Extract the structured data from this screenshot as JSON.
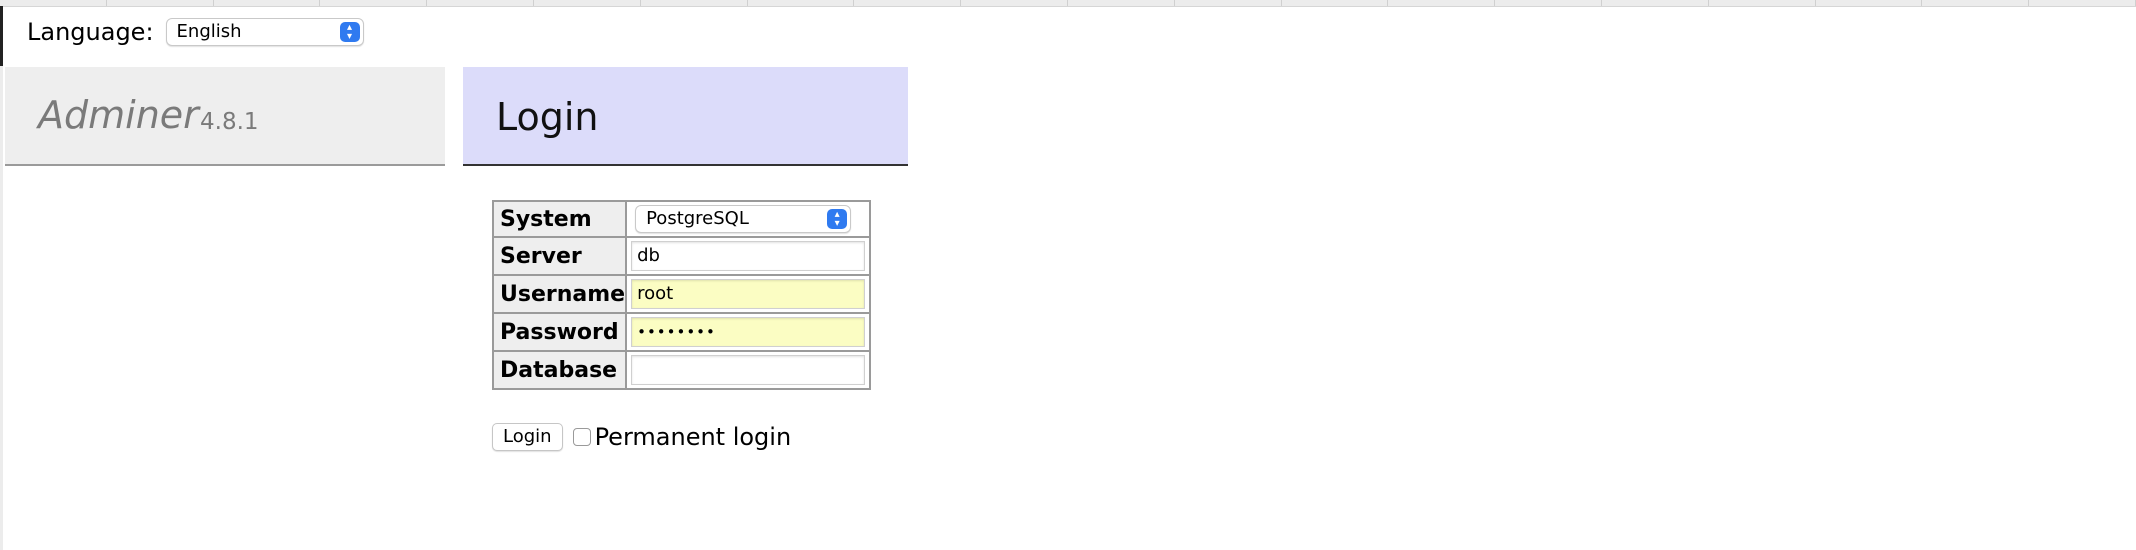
{
  "language": {
    "label": "Language:",
    "selected": "English"
  },
  "brand": {
    "name": "Adminer",
    "version": "4.8.1"
  },
  "login_panel": {
    "title": "Login"
  },
  "form": {
    "rows": [
      {
        "label": "System",
        "value": "PostgreSQL",
        "type": "select"
      },
      {
        "label": "Server",
        "value": "db",
        "type": "text"
      },
      {
        "label": "Username",
        "value": "root",
        "type": "text"
      },
      {
        "label": "Password",
        "value": "••••••••",
        "type": "password"
      },
      {
        "label": "Database",
        "value": "",
        "type": "text"
      }
    ]
  },
  "actions": {
    "login_button": "Login",
    "permanent_login_label": "Permanent login",
    "permanent_login_checked": false
  },
  "colors": {
    "brand_bg": "#eeeeee",
    "login_header_bg": "#dcdcfa",
    "autofill_bg": "#fbfdc3",
    "select_arrow": "#2f7af0"
  }
}
